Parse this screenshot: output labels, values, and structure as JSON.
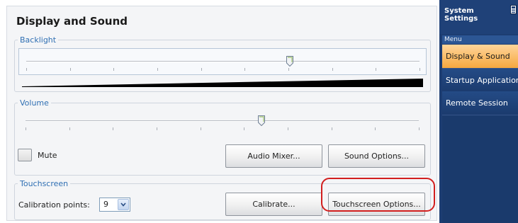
{
  "page": {
    "title": "Display and Sound"
  },
  "backlight": {
    "legend": "Backlight",
    "level": 0.67
  },
  "volume": {
    "legend": "Volume",
    "level": 0.6,
    "mute_label": "Mute",
    "mute_checked": false,
    "audio_mixer_label": "Audio Mixer...",
    "sound_options_label": "Sound Options..."
  },
  "touchscreen": {
    "legend": "Touchscreen",
    "calibration_label": "Calibration points:",
    "calibration_value": "9",
    "calibrate_label": "Calibrate...",
    "options_label": "Touchscreen Options..."
  },
  "sidebar": {
    "title": "System\nSettings",
    "menu_caption": "Menu",
    "items": [
      {
        "label": "Display & Sound",
        "active": true
      },
      {
        "label": "Startup Applications",
        "active": false
      },
      {
        "label": "Remote Session",
        "active": false
      }
    ]
  },
  "colors": {
    "legend": "#2f6fb3",
    "sidebar": "#1d3d72",
    "active_item": "#f6a83f",
    "highlight": "#d21f1f"
  }
}
